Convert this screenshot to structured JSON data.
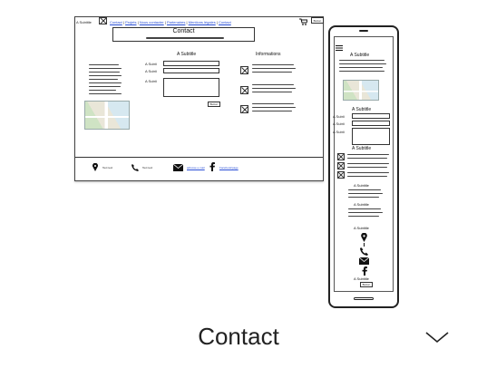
{
  "desktop": {
    "brand": "A Subtitle",
    "nav": [
      "Contact",
      "Projets",
      "Nous contacter",
      "Partenaires",
      "Mentions légales",
      "Contact"
    ],
    "cart_icon": "cart-icon",
    "header_button": "Button",
    "page_title": "Contact",
    "form_title": "A Subtitle",
    "info_title": "Informations",
    "field_labels": [
      "A Subti",
      "A Subti",
      "A Subti"
    ],
    "submit_label": "Button",
    "footer": {
      "address": "Text text",
      "phone": "Text text",
      "email": "adresse e-mail",
      "facebook": "Facebook/page"
    }
  },
  "mobile": {
    "section_title_1": "A Subtitle",
    "section_title_2": "A Subtitle",
    "field_labels": [
      "A Subti",
      "A Subti",
      "A Subti"
    ],
    "section_title_3": "A Subtitle",
    "section_title_4": "A Subtitle",
    "section_title_5": "A Subtitle",
    "section_title_6": "A Subtitle",
    "section_title_7": "A Subtitle",
    "button": "Button"
  },
  "caption": "Contact"
}
